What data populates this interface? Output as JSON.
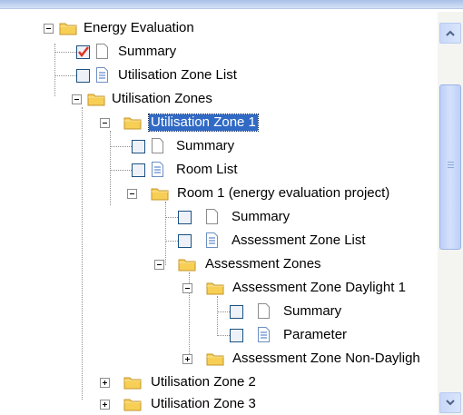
{
  "tree": {
    "energy_evaluation": "Energy Evaluation",
    "summary": "Summary",
    "utilisation_zone_list": "Utilisation Zone List",
    "utilisation_zones": "Utilisation Zones",
    "utilisation_zone_1": "Utilisation Zone 1",
    "room_list": "Room List",
    "room_1": "Room 1 (energy evaluation project)",
    "assessment_zone_list": "Assessment Zone List",
    "assessment_zones": "Assessment Zones",
    "assessment_zone_daylight_1": "Assessment Zone Daylight 1",
    "parameter": "Parameter",
    "assessment_zone_non_daylight": "Assessment Zone Non-Dayligh",
    "utilisation_zone_2": "Utilisation Zone 2",
    "utilisation_zone_3": "Utilisation Zone 3"
  },
  "state": {
    "checked_item": "Summary",
    "selected_item": "Utilisation Zone 1"
  },
  "icons": {
    "folder": "folder-icon",
    "document": "document-icon",
    "list_document": "list-document-icon"
  },
  "colors": {
    "selection": "#316ac5",
    "check": "#e0321e",
    "folder": "#f7cf55"
  }
}
